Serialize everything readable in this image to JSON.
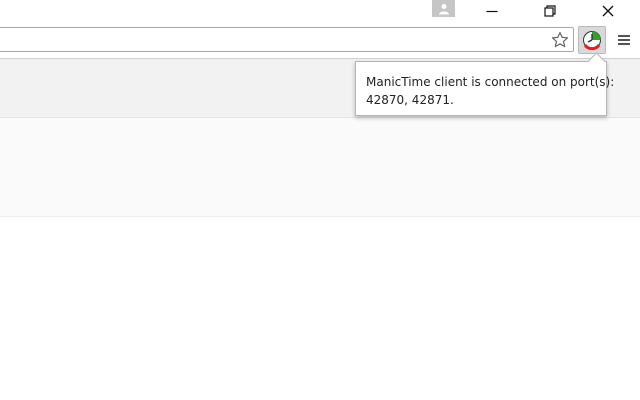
{
  "window": {
    "icons": {
      "profile": "person-icon",
      "minimize": "minimize-icon",
      "restore": "restore-icon",
      "close": "close-icon"
    }
  },
  "toolbar": {
    "omnibox_value": "",
    "icons": {
      "bookmark": "star-icon",
      "extension": "manictime-icon",
      "menu": "hamburger-menu-icon"
    }
  },
  "popup": {
    "line1": "ManicTime client is connected on port(s):",
    "line2": "42870, 42871."
  },
  "colors": {
    "extension_red": "#e02020",
    "extension_green": "#2aa52a"
  }
}
